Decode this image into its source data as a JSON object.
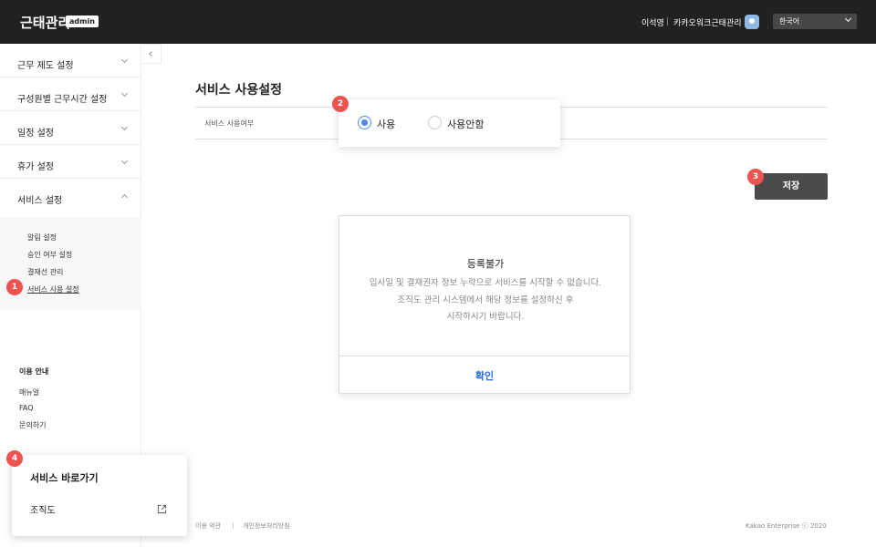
{
  "header": {
    "brand": "근태관리",
    "admin_badge": "admin",
    "user_name": "이석영",
    "org_name": "카카오워크근태관리",
    "language": "한국어"
  },
  "sidebar": {
    "menu": [
      {
        "label": "근무 제도 설정",
        "expanded": false
      },
      {
        "label": "구성원별 근무시간 설정",
        "expanded": false
      },
      {
        "label": "일정 설정",
        "expanded": false
      },
      {
        "label": "휴가 설정",
        "expanded": false
      },
      {
        "label": "서비스 설정",
        "expanded": true
      }
    ],
    "submenu": [
      "알림 설정",
      "승인 여부 설정",
      "결재선 관리",
      "서비스 사용 설정"
    ],
    "help_title": "이용 안내",
    "help_items": [
      "매뉴얼",
      "FAQ",
      "문의하기"
    ]
  },
  "main": {
    "title": "서비스 사용설정",
    "field_label": "서비스 사용여부",
    "radio_options": [
      "사용",
      "사용안함"
    ],
    "selected": "사용",
    "save_label": "저장"
  },
  "modal": {
    "title": "등록불가",
    "message_lines": [
      "입사일 및 결재권자 정보 누락으로 서비스를 시작할 수 없습니다.",
      "조직도 관리 시스템에서 해당 정보를 설정하신 후",
      "시작하시기 바랍니다."
    ],
    "confirm_label": "확인"
  },
  "shortcut": {
    "title": "서비스 바로가기",
    "item": "조직도"
  },
  "footer": {
    "terms": "이용 약관",
    "privacy": "개인정보처리방침",
    "copyright": "Kakao Enterprise ⓒ 2020"
  },
  "markers": [
    "1",
    "2",
    "3",
    "4"
  ],
  "colors": {
    "accent": "#4b89f0",
    "marker": "#ef5350",
    "topbar": "#212121",
    "link": "#2e6dd8"
  }
}
